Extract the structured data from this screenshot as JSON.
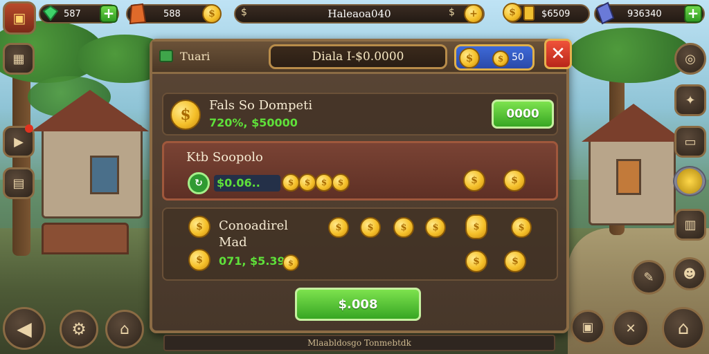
{
  "hud": {
    "gems": "587",
    "energy": "588",
    "title": "Haleaoa040",
    "title_suffix": "$",
    "coins": "$6509",
    "wood": "936340"
  },
  "panel": {
    "header_title": "Tuari",
    "balance": "Diala I-$0.0000",
    "gold_badge": "50",
    "close_label": "✕",
    "row1": {
      "title": "Fals So Dompeti",
      "value": "720%, $50000",
      "button": "0000"
    },
    "row2": {
      "title": "Ktb  Soopolo",
      "value": "$0.06.."
    },
    "row3": {
      "title_line1": "Conoadirel",
      "title_line2": "Mad",
      "value": "071, $5.39"
    },
    "main_button": "$.008"
  },
  "footer": {
    "text": "Mlaabldosgo Tonmebtdk"
  },
  "colors": {
    "accent_green": "#5fe03a",
    "gold": "#f5c02a",
    "close_red": "#d8341f"
  }
}
